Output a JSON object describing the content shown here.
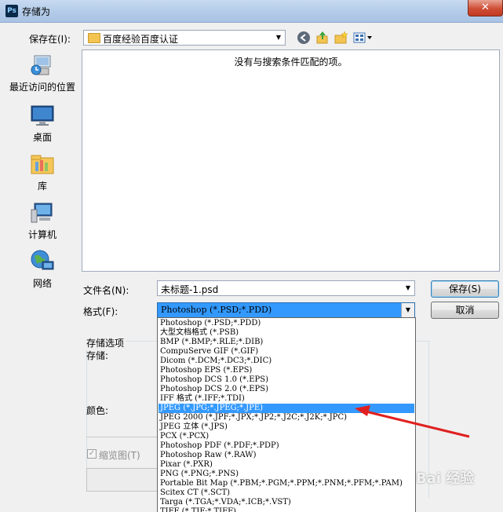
{
  "window": {
    "title": "存储为",
    "app_icon": "Ps",
    "close_symbol": "✕"
  },
  "save_in": {
    "label": "保存在(I):",
    "value": "百度经验百度认证"
  },
  "places": [
    {
      "name": "recent",
      "label": "最近访问的位置",
      "icon": "recent-places-icon"
    },
    {
      "name": "desktop",
      "label": "桌面",
      "icon": "desktop-icon"
    },
    {
      "name": "library",
      "label": "库",
      "icon": "library-icon"
    },
    {
      "name": "computer",
      "label": "计算机",
      "icon": "computer-icon"
    },
    {
      "name": "network",
      "label": "网络",
      "icon": "network-icon"
    }
  ],
  "filelist": {
    "empty_message": "没有与搜索条件匹配的项。"
  },
  "filename": {
    "label": "文件名(N):",
    "value": "未标题-1.psd"
  },
  "format": {
    "label": "格式(F):",
    "selected": "Photoshop (*.PSD;*.PDD)",
    "options": [
      "Photoshop (*.PSD;*.PDD)",
      "大型文档格式 (*.PSB)",
      "BMP (*.BMP;*.RLE;*.DIB)",
      "CompuServe GIF (*.GIF)",
      "Dicom (*.DCM;*.DC3;*.DIC)",
      "Photoshop EPS (*.EPS)",
      "Photoshop DCS 1.0 (*.EPS)",
      "Photoshop DCS 2.0 (*.EPS)",
      "IFF 格式 (*.IFF;*.TDI)",
      "JPEG (*.JPG;*.JPEG;*.JPE)",
      "JPEG 2000 (*.JPF;*.JPX;*.JP2;*.J2C;*.J2K;*.JPC)",
      "JPEG 立体 (*.JPS)",
      "PCX (*.PCX)",
      "Photoshop PDF (*.PDF;*.PDP)",
      "Photoshop Raw (*.RAW)",
      "Pixar (*.PXR)",
      "PNG (*.PNG;*.PNS)",
      "Portable Bit Map (*.PBM;*.PGM;*.PPM;*.PNM;*.PFM;*.PAM)",
      "Scitex CT (*.SCT)",
      "Targa (*.TGA;*.VDA;*.ICB;*.VST)",
      "TIFF (*.TIF;*.TIFF)"
    ],
    "highlighted_index": 9
  },
  "buttons": {
    "save": "保存(S)",
    "cancel": "取消"
  },
  "options": {
    "group_label": "存储选项",
    "store_label": "存储:",
    "color_label": "颜色:",
    "thumbnail_label": "缩览图(T)",
    "thumbnail_checked": true
  },
  "watermark": "Bai 经验"
}
